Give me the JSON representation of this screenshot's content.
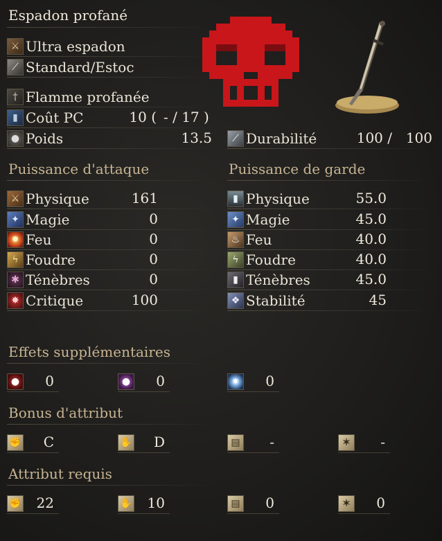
{
  "item": {
    "name": "Espadon profané"
  },
  "info": {
    "weapon_type": "Ultra espadon",
    "attack_type": "Standard/Estoc",
    "skill": "Flamme profanée",
    "fp_label": "Coût PC",
    "fp_value": "10 (",
    "fp_range": "- / 17 )",
    "weight_label": "Poids",
    "weight_value": "13.5",
    "durability_label": "Durabilité",
    "durability_current": "100 /",
    "durability_max": "100"
  },
  "attack": {
    "title": "Puissance d'attaque",
    "rows": [
      {
        "label": "Physique",
        "value": "161",
        "icon": "physical-attack-icon"
      },
      {
        "label": "Magie",
        "value": "0",
        "icon": "magic-attack-icon"
      },
      {
        "label": "Feu",
        "value": "0",
        "icon": "fire-attack-icon"
      },
      {
        "label": "Foudre",
        "value": "0",
        "icon": "lightning-attack-icon"
      },
      {
        "label": "Ténèbres",
        "value": "0",
        "icon": "dark-attack-icon"
      },
      {
        "label": "Critique",
        "value": "100",
        "icon": "critical-icon"
      }
    ]
  },
  "guard": {
    "title": "Puissance de garde",
    "rows": [
      {
        "label": "Physique",
        "value": "55.0",
        "icon": "physical-guard-icon"
      },
      {
        "label": "Magie",
        "value": "45.0",
        "icon": "magic-guard-icon"
      },
      {
        "label": "Feu",
        "value": "40.0",
        "icon": "fire-guard-icon"
      },
      {
        "label": "Foudre",
        "value": "40.0",
        "icon": "lightning-guard-icon"
      },
      {
        "label": "Ténèbres",
        "value": "45.0",
        "icon": "dark-guard-icon"
      },
      {
        "label": "Stabilité",
        "value": "45",
        "icon": "stability-icon"
      }
    ]
  },
  "effects": {
    "title": "Effets supplémentaires",
    "items": [
      {
        "icon": "bleed-icon",
        "value": "0"
      },
      {
        "icon": "poison-icon",
        "value": "0"
      },
      {
        "icon": "frost-icon",
        "value": "0"
      }
    ]
  },
  "scaling": {
    "title": "Bonus d'attribut",
    "items": [
      {
        "icon": "strength-icon",
        "value": "C"
      },
      {
        "icon": "dexterity-icon",
        "value": "D"
      },
      {
        "icon": "intelligence-icon",
        "value": "-"
      },
      {
        "icon": "faith-icon",
        "value": "-"
      }
    ]
  },
  "requirements": {
    "title": "Attribut requis",
    "items": [
      {
        "icon": "strength-icon",
        "value": "22"
      },
      {
        "icon": "dexterity-icon",
        "value": "10"
      },
      {
        "icon": "intelligence-icon",
        "value": "0"
      },
      {
        "icon": "faith-icon",
        "value": "0"
      }
    ]
  },
  "colors": {
    "skull": "#c8161b",
    "section_title": "#c7b493",
    "text": "#e9e4d6"
  }
}
